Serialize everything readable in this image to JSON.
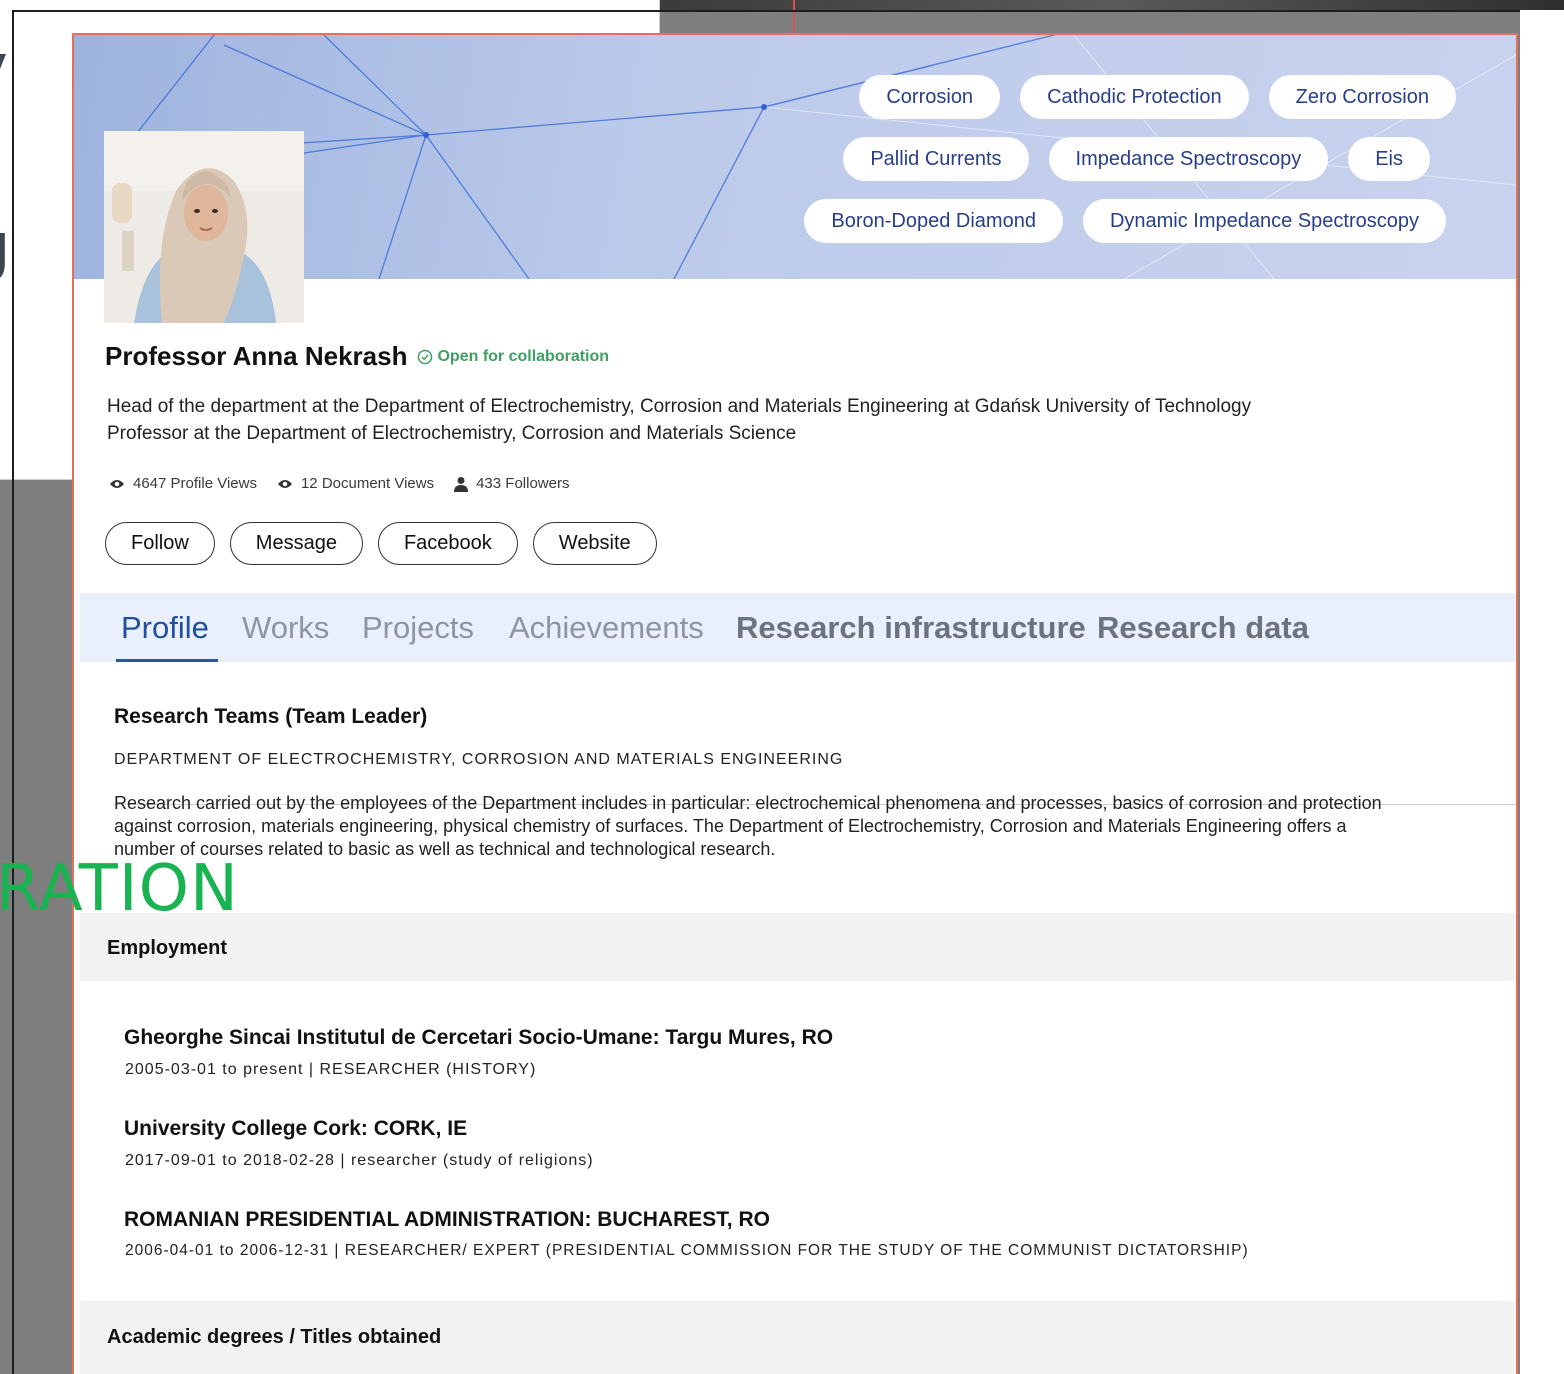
{
  "background": {
    "fragments": [
      "y",
      "g",
      "s"
    ],
    "green_fragment": "RATION"
  },
  "banner": {
    "tags": [
      [
        "Corrosion",
        "Cathodic Protection",
        "Zero Corrosion"
      ],
      [
        "Pallid Currents",
        "Impedance Spectroscopy",
        "Eis"
      ],
      [
        "Boron-Doped Diamond",
        "Dynamic Impedance Spectroscopy"
      ]
    ]
  },
  "profile": {
    "name": "Professor Anna Nekrash",
    "collab": "Open for collaboration",
    "desc_line1": "Head of the department at the Department of Electrochemistry, Corrosion and Materials Engineering at Gdańsk University of Technology",
    "desc_line2": "Professor at the Department of Electrochemistry, Corrosion and Materials Science",
    "stats": {
      "profile_views": "4647 Profile Views",
      "document_views": "12 Document Views",
      "followers": "433 Followers"
    },
    "buttons": {
      "follow": "Follow",
      "message": "Message",
      "facebook": "Facebook",
      "website": "Website"
    }
  },
  "tabs": {
    "profile": "Profile",
    "works": "Works",
    "projects": "Projects",
    "achievements": "Achievements",
    "research_infrastructure": "Research infrastructure",
    "research_data": "Research data"
  },
  "research_teams": {
    "title": "Research Teams (Team Leader)",
    "department": "DEPARTMENT OF ELECTROCHEMISTRY, CORROSION AND MATERIALS ENGINEERING",
    "text": "Research carried out by the employees of the Department includes in particular: electrochemical phenomena and processes, basics of corrosion and protection against corrosion, materials engineering, physical chemistry of surfaces. The Department of Electrochemistry, Corrosion and Materials Engineering offers a number of courses related to basic as well as technical and technological research."
  },
  "employment": {
    "title": "Employment",
    "jobs": [
      {
        "org": "Gheorghe Sincai Institutul de Cercetari Socio-Umane: Targu Mures, RO",
        "meta": "2005-03-01 to present | RESEARCHER (HISTORY)"
      },
      {
        "org": "University College Cork: CORK, IE",
        "meta": "2017-09-01 to 2018-02-28 | researcher (study of religions)"
      },
      {
        "org": "ROMANIAN PRESIDENTIAL ADMINISTRATION: BUCHAREST, RO",
        "meta": "2006-04-01 to 2006-12-31 | RESEARCHER/ EXPERT (PRESIDENTIAL COMMISSION FOR THE STUDY OF THE COMMUNIST DICTATORSHIP)"
      }
    ]
  },
  "academic": {
    "title": "Academic degrees / Titles obtained"
  },
  "colors": {
    "accent": "#1f4f9f",
    "collab_green": "#3f9e63",
    "card_border": "#e2705f",
    "tag_text": "#283e8a"
  }
}
